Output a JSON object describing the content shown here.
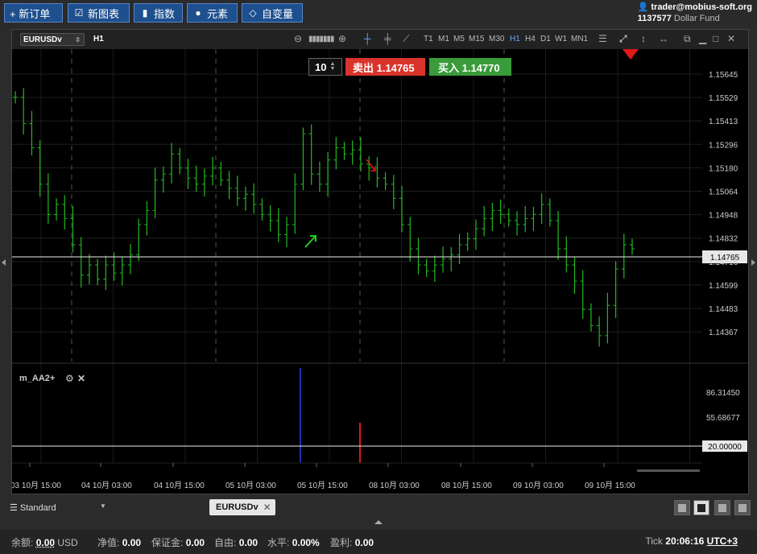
{
  "toolbar": {
    "buttons": [
      {
        "label": "+ 新订单",
        "icon": "plus-icon"
      },
      {
        "label": "新图表",
        "icon": "chart-icon"
      },
      {
        "label": "指数",
        "icon": "bar-chart-icon"
      },
      {
        "label": "元素",
        "icon": "shapes-icon"
      },
      {
        "label": "自变量",
        "icon": "diamond-icon"
      }
    ]
  },
  "account": {
    "email": "trader@mobius-soft.org",
    "number": "1137577",
    "fund": "Dollar Fund"
  },
  "chart_toolbar": {
    "symbol": "EURUSDv",
    "timeframe": "H1",
    "timeframes": [
      "T1",
      "M1",
      "M5",
      "M15",
      "M30",
      "H1",
      "H4",
      "D1",
      "W1",
      "MN1"
    ],
    "active_timeframe": "H1"
  },
  "trade": {
    "lot": "10",
    "sell_label": "卖出 1.14765",
    "buy_label": "买入 1.14770"
  },
  "chart_data": {
    "type": "bar",
    "symbol": "EURUSDv",
    "timeframe": "H1",
    "price_ticks": [
      "1.15645",
      "1.15529",
      "1.15413",
      "1.15296",
      "1.15180",
      "1.15064",
      "1.14948",
      "1.14832",
      "1.14716",
      "1.14599",
      "1.14483",
      "1.14367"
    ],
    "current_price": "1.14765",
    "time_labels": [
      "03 10月 15:00",
      "04 10月 03:00",
      "04 10月 15:00",
      "05 10月 03:00",
      "05 10月 15:00",
      "08 10月 03:00",
      "08 10月 15:00",
      "09 10月 03:00",
      "09 10月 15:00"
    ],
    "bar_color": "#22b822",
    "indicator": {
      "name": "m_AA2+",
      "ticks": [
        "86.31450",
        "55.68677"
      ],
      "level": "20.00000",
      "series": [
        {
          "color": "#1c2fb4",
          "value": 100
        },
        {
          "color": "#e01818",
          "value": 20
        }
      ]
    }
  },
  "bottom": {
    "profile": "Standard",
    "tab": "EURUSDv"
  },
  "status": {
    "balance_label": "余额:",
    "balance": "0.00",
    "currency": "USD",
    "equity_label": "净值:",
    "equity": "0.00",
    "margin_label": "保证金:",
    "margin": "0.00",
    "free_label": "自由:",
    "free": "0.00",
    "level_label": "水平:",
    "level": "0.00%",
    "profit_label": "盈利:",
    "profit": "0.00",
    "tick_label": "Tick",
    "time": "20:06:16",
    "tz": "UTC+3"
  }
}
